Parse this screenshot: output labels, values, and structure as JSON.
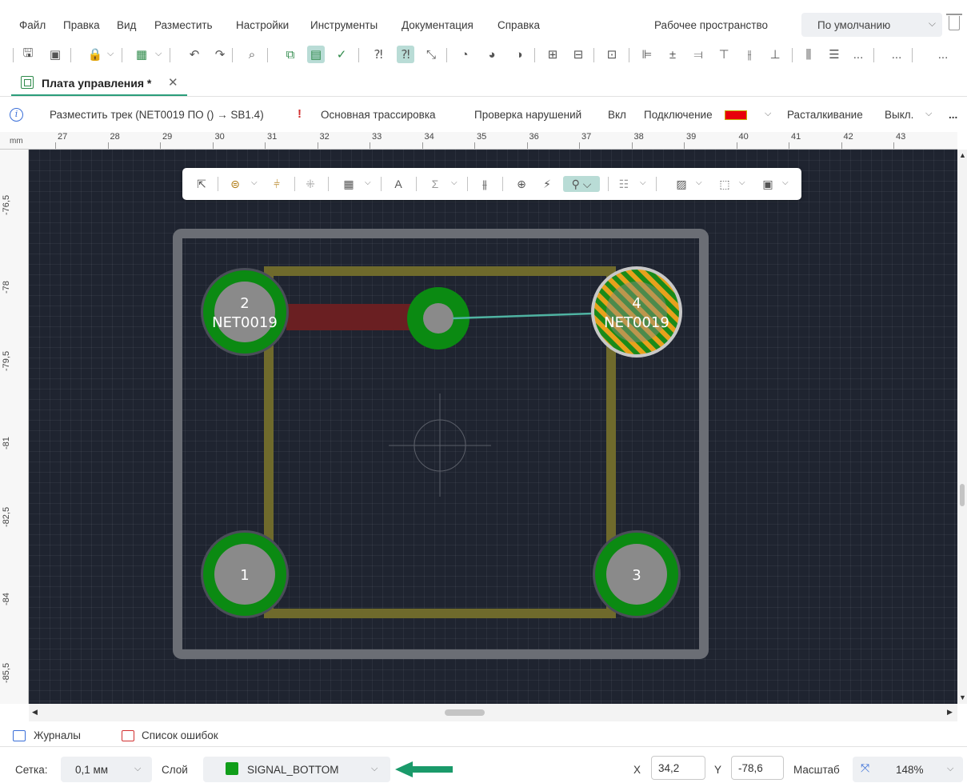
{
  "menu": {
    "items": [
      "Файл",
      "Правка",
      "Вид",
      "Разместить",
      "Настройки",
      "Инструменты",
      "Документация",
      "Справка"
    ],
    "workspace_label": "Рабочее пространство",
    "workspace_value": "По умолчанию"
  },
  "toolbar": {
    "icons": [
      "save-icon",
      "save-all-icon",
      "lock-icon",
      "grid-icon",
      "undo-icon",
      "redo-icon",
      "zoom-icon",
      "board-icon",
      "board-view-icon",
      "check-icon",
      "drc-icon",
      "drc-active-icon",
      "route-icon",
      "shape-icon",
      "shape2-icon",
      "shape3-icon",
      "component-icon",
      "component2-icon",
      "align-left-icon",
      "align-center-icon",
      "align-right-icon",
      "align-top-icon",
      "align-middle-icon",
      "align-bottom-icon",
      "distribute-icon",
      "distribute2-icon",
      "more-icon"
    ],
    "overflow_label": "..."
  },
  "tab": {
    "label": "Плата управления *"
  },
  "info": {
    "place_track": "Разместить трек (NET0019 ПО () → SB1.4)",
    "routing": "Основная трассировка",
    "drc_label": "Проверка нарушений",
    "drc_value": "Вкл",
    "connection_label": "Подключение",
    "connection_color": "#e8000b",
    "push_label": "Расталкивание",
    "push_value": "Выкл.",
    "more": "..."
  },
  "ruler": {
    "unit": "mm",
    "x_ticks": [
      "27",
      "28",
      "29",
      "30",
      "31",
      "32",
      "33",
      "34",
      "35",
      "36",
      "37",
      "38",
      "39",
      "40",
      "41",
      "42",
      "43"
    ],
    "y_ticks": [
      "-76,5",
      "-78",
      "-79,5",
      "-81",
      "-82,5",
      "-84",
      "-85,5"
    ]
  },
  "pcb": {
    "pads": [
      {
        "number": "2",
        "net": "NET0019"
      },
      {
        "number": "4",
        "net": "NET0019"
      },
      {
        "number": "1",
        "net": ""
      },
      {
        "number": "3",
        "net": ""
      }
    ],
    "colors": {
      "background": "#1f2430",
      "outline": "#6b6e75",
      "silkscreen": "#6f6a2c",
      "pad_ring": "#0b8a12",
      "pad_center": "#8a8a8a",
      "track": "#6a1f22",
      "ratsnest": "#4fb3a2",
      "pad_hatch_a": "#e8a11c",
      "pad_hatch_b": "#1a8a1a"
    }
  },
  "canvas_toolbar": {
    "icons": [
      "select-icon",
      "route-icon",
      "diff-pair-icon",
      "via-grid-icon",
      "table-icon",
      "text-icon",
      "sum-icon",
      "tune-icon",
      "crosshair-icon",
      "fanout-icon",
      "probe-icon",
      "layers-icon",
      "hatch-icon",
      "region-icon",
      "board-outline-icon"
    ]
  },
  "panels": {
    "logs": "Журналы",
    "errors": "Список ошибок"
  },
  "status": {
    "grid_label": "Сетка:",
    "grid_value": "0,1 мм",
    "layer_label": "Слой",
    "layer_value": "SIGNAL_BOTTOM",
    "layer_color": "#119e1a",
    "x_label": "X",
    "x_value": "34,2",
    "y_label": "Y",
    "y_value": "-78,6",
    "zoom_label": "Масштаб",
    "zoom_value": "148%"
  }
}
